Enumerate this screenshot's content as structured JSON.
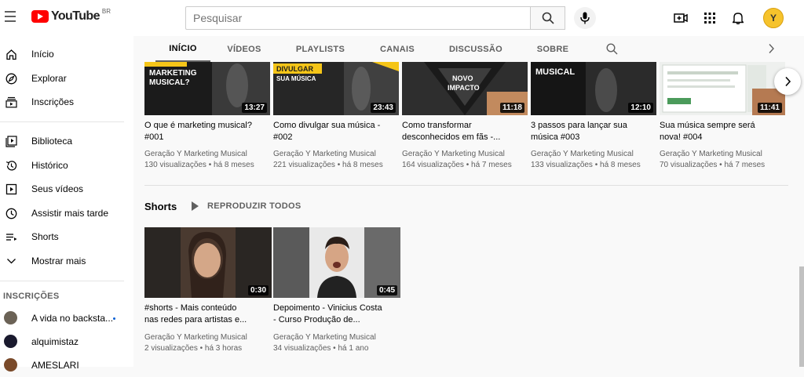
{
  "header": {
    "logo_text": "YouTube",
    "logo_region": "BR",
    "search_placeholder": "Pesquisar",
    "avatar_letter": "Y"
  },
  "sidebar": {
    "main_items": [
      {
        "label": "Início",
        "icon": "home-icon"
      },
      {
        "label": "Explorar",
        "icon": "compass-icon"
      },
      {
        "label": "Inscrições",
        "icon": "subscriptions-icon"
      }
    ],
    "library_items": [
      {
        "label": "Biblioteca",
        "icon": "library-icon"
      },
      {
        "label": "Histórico",
        "icon": "history-icon"
      },
      {
        "label": "Seus vídeos",
        "icon": "your-videos-icon"
      },
      {
        "label": "Assistir mais tarde",
        "icon": "watch-later-icon"
      },
      {
        "label": "Shorts",
        "icon": "shorts-icon"
      },
      {
        "label": "Mostrar mais",
        "icon": "chevron-down-icon"
      }
    ],
    "subscriptions_heading": "INSCRIÇÕES",
    "subscriptions": [
      {
        "label": "A vida no backsta...",
        "avatar_color": "#6b6256",
        "new_content": true
      },
      {
        "label": "alquimistaz",
        "avatar_color": "#1a1a2e",
        "new_content": false
      },
      {
        "label": "AMESLARI",
        "avatar_color": "#7a4a2a",
        "new_content": false
      }
    ]
  },
  "tabs": [
    {
      "label": "INÍCIO",
      "active": true
    },
    {
      "label": "VÍDEOS",
      "active": false
    },
    {
      "label": "PLAYLISTS",
      "active": false
    },
    {
      "label": "CANAIS",
      "active": false
    },
    {
      "label": "DISCUSSÃO",
      "active": false
    },
    {
      "label": "SOBRE",
      "active": false
    }
  ],
  "videos": [
    {
      "title": "O que é marketing musical?\n#001",
      "channel": "Geração Y Marketing Musical",
      "views": "130 visualizações",
      "age": "há 8 meses",
      "duration": "13:27",
      "thumb_text": "MARKETING\nMUSICAL?"
    },
    {
      "title": "Como divulgar sua música -\n#002",
      "channel": "Geração Y Marketing Musical",
      "views": "221 visualizações",
      "age": "há 8 meses",
      "duration": "23:43",
      "thumb_text": "DIVULGAR\nSUA MÚSICA"
    },
    {
      "title": "Como transformar\ndesconhecidos em fãs -...",
      "channel": "Geração Y Marketing Musical",
      "views": "164 visualizações",
      "age": "há 7 meses",
      "duration": "11:18",
      "thumb_text": "NOVO\nIMPACTO"
    },
    {
      "title": "3 passos para lançar sua\nmúsica #003",
      "channel": "Geração Y Marketing Musical",
      "views": "133 visualizações",
      "age": "há 8 meses",
      "duration": "12:10",
      "thumb_text": "MUSICAL"
    },
    {
      "title": "Sua música sempre será\nnova! #004",
      "channel": "Geração Y Marketing Musical",
      "views": "70 visualizações",
      "age": "há 7 meses",
      "duration": "11:41",
      "thumb_text": ""
    }
  ],
  "shorts_shelf": {
    "title": "Shorts",
    "play_all": "REPRODUZIR TODOS"
  },
  "shorts": [
    {
      "title": "#shorts - Mais conteúdo\nnas redes para artistas e...",
      "channel": "Geração Y Marketing Musical",
      "views": "2 visualizações",
      "age": "há 3 horas",
      "duration": "0:30"
    },
    {
      "title": "Depoimento - Vinicius Costa\n- Curso Produção de...",
      "channel": "Geração Y Marketing Musical",
      "views": "34 visualizações",
      "age": "há 1 ano",
      "duration": "0:45"
    }
  ],
  "meta_separator": "•",
  "colors": {
    "brand_red": "#ff0000",
    "accent_yellow": "#f5c518",
    "link_blue": "#065fd4"
  }
}
